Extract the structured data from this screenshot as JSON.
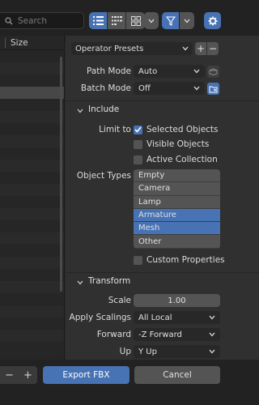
{
  "search": {
    "placeholder": "Search"
  },
  "filelist": {
    "size_header": "Size"
  },
  "presets": {
    "label": "Operator Presets",
    "add": "+",
    "remove": "−"
  },
  "fields": {
    "path_mode": {
      "label": "Path Mode",
      "value": "Auto"
    },
    "batch_mode": {
      "label": "Batch Mode",
      "value": "Off"
    }
  },
  "include": {
    "title": "Include",
    "limit_to_label": "Limit to",
    "checks": [
      {
        "label": "Selected Objects",
        "checked": true
      },
      {
        "label": "Visible Objects",
        "checked": false
      },
      {
        "label": "Active Collection",
        "checked": false
      }
    ],
    "object_types_label": "Object Types",
    "object_types": [
      {
        "label": "Empty",
        "selected": false
      },
      {
        "label": "Camera",
        "selected": false
      },
      {
        "label": "Lamp",
        "selected": false
      },
      {
        "label": "Armature",
        "selected": true
      },
      {
        "label": "Mesh",
        "selected": true
      },
      {
        "label": "Other",
        "selected": false
      }
    ],
    "custom_properties": {
      "label": "Custom Properties",
      "checked": false
    }
  },
  "transform": {
    "title": "Transform",
    "scale": {
      "label": "Scale",
      "value": "1.00"
    },
    "apply_scalings": {
      "label": "Apply Scalings",
      "value": "All Local"
    },
    "forward": {
      "label": "Forward",
      "value": "-Z Forward"
    },
    "up": {
      "label": "Up",
      "value": "Y Up"
    }
  },
  "footer": {
    "minus": "−",
    "plus": "+",
    "export": "Export FBX",
    "cancel": "Cancel"
  },
  "colors": {
    "accent": "#4772b3",
    "panel": "#303030",
    "field": "#282828",
    "button": "#545454"
  }
}
